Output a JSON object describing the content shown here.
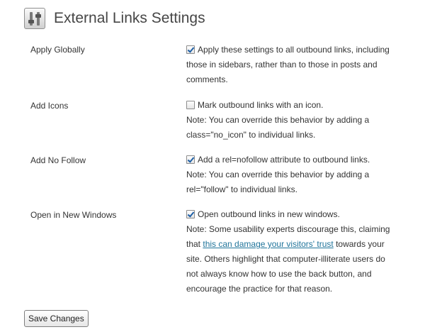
{
  "page": {
    "title": "External Links Settings",
    "icon": "settings-sliders-icon"
  },
  "settings": [
    {
      "label": "Apply Globally",
      "checked": true,
      "option": "Apply these settings to all outbound links, including",
      "lines": [
        "those in sidebars, rather than to those in posts and",
        "comments."
      ]
    },
    {
      "label": "Add Icons",
      "checked": false,
      "option": "Mark outbound links with an icon.",
      "lines": [
        "Note: You can override this behavior by adding a",
        "class=\"no_icon\" to individual links."
      ]
    },
    {
      "label": "Add No Follow",
      "checked": true,
      "option": "Add a rel=nofollow attribute to outbound links.",
      "lines": [
        "Note: You can override this behavior by adding a",
        "rel=\"follow\" to individual links."
      ]
    },
    {
      "label": "Open in New Windows",
      "checked": true,
      "option": "Open outbound links in new windows.",
      "line1": "Note: Some usability experts discourage this, claiming",
      "line2_pre": "that ",
      "link_text": "this can damage your visitors' trust",
      "line2_post": " towards your",
      "lines": [
        "site. Others highlight that computer-illiterate users do",
        "not always know how to use the back button, and",
        "encourage the practice for that reason."
      ]
    }
  ],
  "actions": {
    "save_label": "Save Changes"
  },
  "colors": {
    "link": "#21759b",
    "text": "#333333",
    "title": "#464646"
  }
}
